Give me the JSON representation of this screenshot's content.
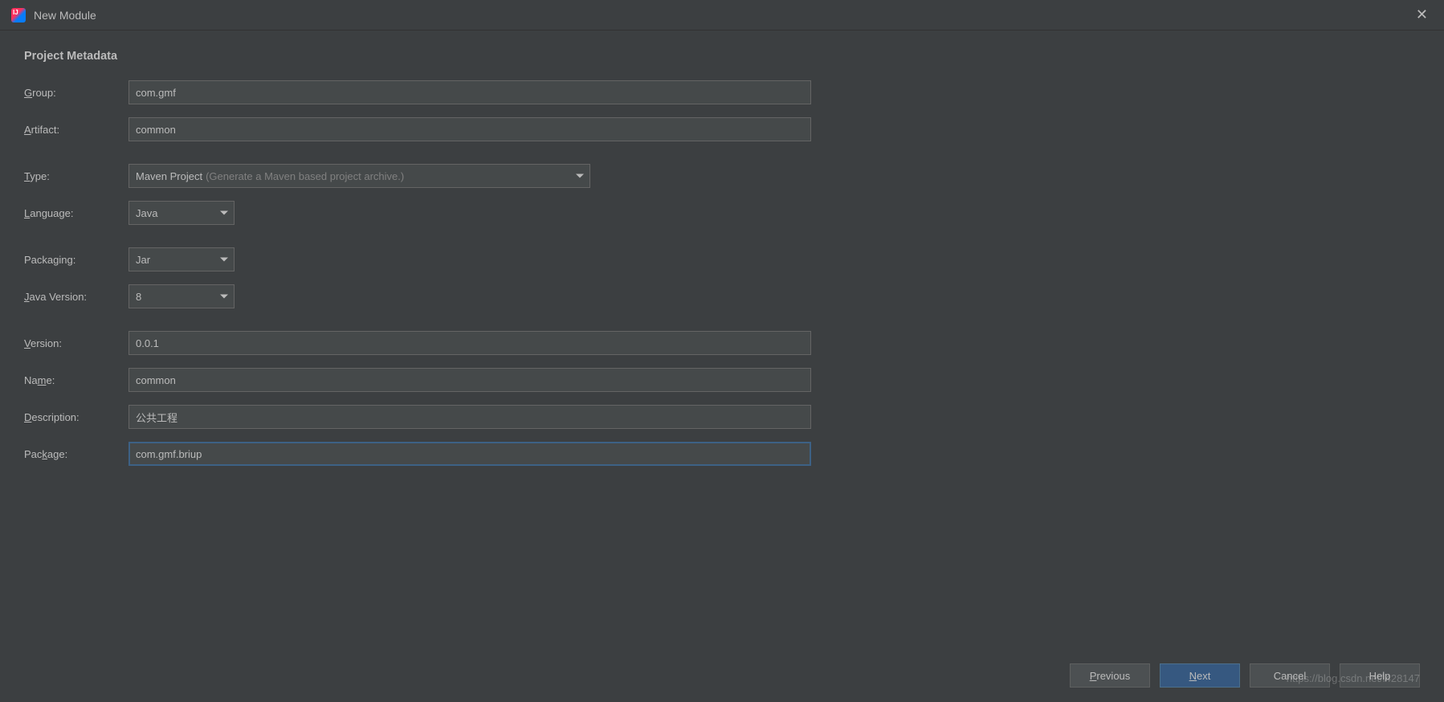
{
  "titlebar": {
    "title": "New Module"
  },
  "section": {
    "title": "Project Metadata"
  },
  "labels": {
    "group": "Group:",
    "artifact": "Artifact:",
    "type": "Type:",
    "language": "Language:",
    "packaging": "Packaging:",
    "java_version": "Java Version:",
    "version": "Version:",
    "name": "Name:",
    "description": "Description:",
    "package": "Package:"
  },
  "mnemonics": {
    "group": "G",
    "artifact": "A",
    "type": "T",
    "language": "L",
    "packaging": "g",
    "java_version": "J",
    "version": "V",
    "name": "m",
    "description": "D",
    "package": "k"
  },
  "fields": {
    "group": "com.gmf",
    "artifact": "common",
    "type": "Maven Project",
    "type_hint": "(Generate a Maven based project archive.)",
    "language": "Java",
    "packaging": "Jar",
    "java_version": "8",
    "version": "0.0.1",
    "name": "common",
    "description": "公共工程",
    "package": "com.gmf.briup"
  },
  "buttons": {
    "previous": "Previous",
    "next": "Next",
    "cancel": "Cancel",
    "help": "Help"
  },
  "watermark": "https://blog.csdn.net/l428147"
}
